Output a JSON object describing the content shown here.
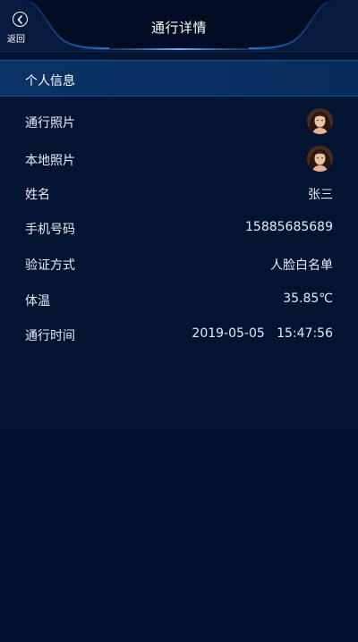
{
  "header": {
    "back_label": "返回",
    "title": "通行详情"
  },
  "section": {
    "title": "个人信息"
  },
  "rows": {
    "pass_photo": {
      "label": "通行照片"
    },
    "local_photo": {
      "label": "本地照片"
    },
    "name": {
      "label": "姓名",
      "value": "张三"
    },
    "phone": {
      "label": "手机号码",
      "value": "15885685689"
    },
    "verify": {
      "label": "验证方式",
      "value": "人脸白名单"
    },
    "temperature": {
      "label": "体温",
      "value": "35.85℃"
    },
    "pass_time": {
      "label": "通行时间",
      "value": "2019-05-05   15:47:56"
    }
  },
  "colors": {
    "background": "#031431",
    "header": "#020c22",
    "section_bar": "#0a2f61",
    "accent_glow": "#2f7fe0",
    "text": "#e6ecf7"
  },
  "icons": {
    "back": "chevron-left-circle-icon",
    "avatar": "face-photo"
  }
}
